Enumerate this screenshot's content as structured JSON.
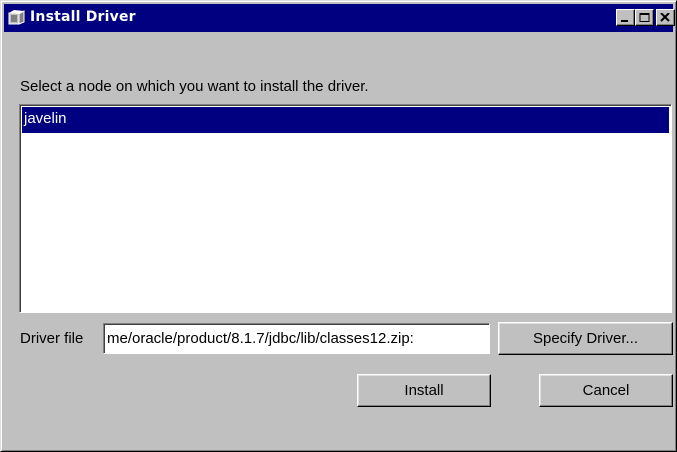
{
  "window": {
    "title": "Install Driver",
    "icon": "driver-package-icon",
    "controls": [
      "minimize-icon",
      "maximize-icon",
      "close-icon"
    ]
  },
  "prompt": "Select a node on which you want to install the driver.",
  "nodes": {
    "items": [
      "javelin"
    ],
    "selected": "javelin"
  },
  "driver": {
    "label": "Driver file",
    "value": "me/oracle/product/8.1.7/jdbc/lib/classes12.zip:"
  },
  "buttons": {
    "specify": "Specify Driver...",
    "install": "Install",
    "cancel": "Cancel"
  },
  "colors": {
    "titlebar": "#000080",
    "selection": "#000080",
    "face": "#c0c0c0"
  }
}
